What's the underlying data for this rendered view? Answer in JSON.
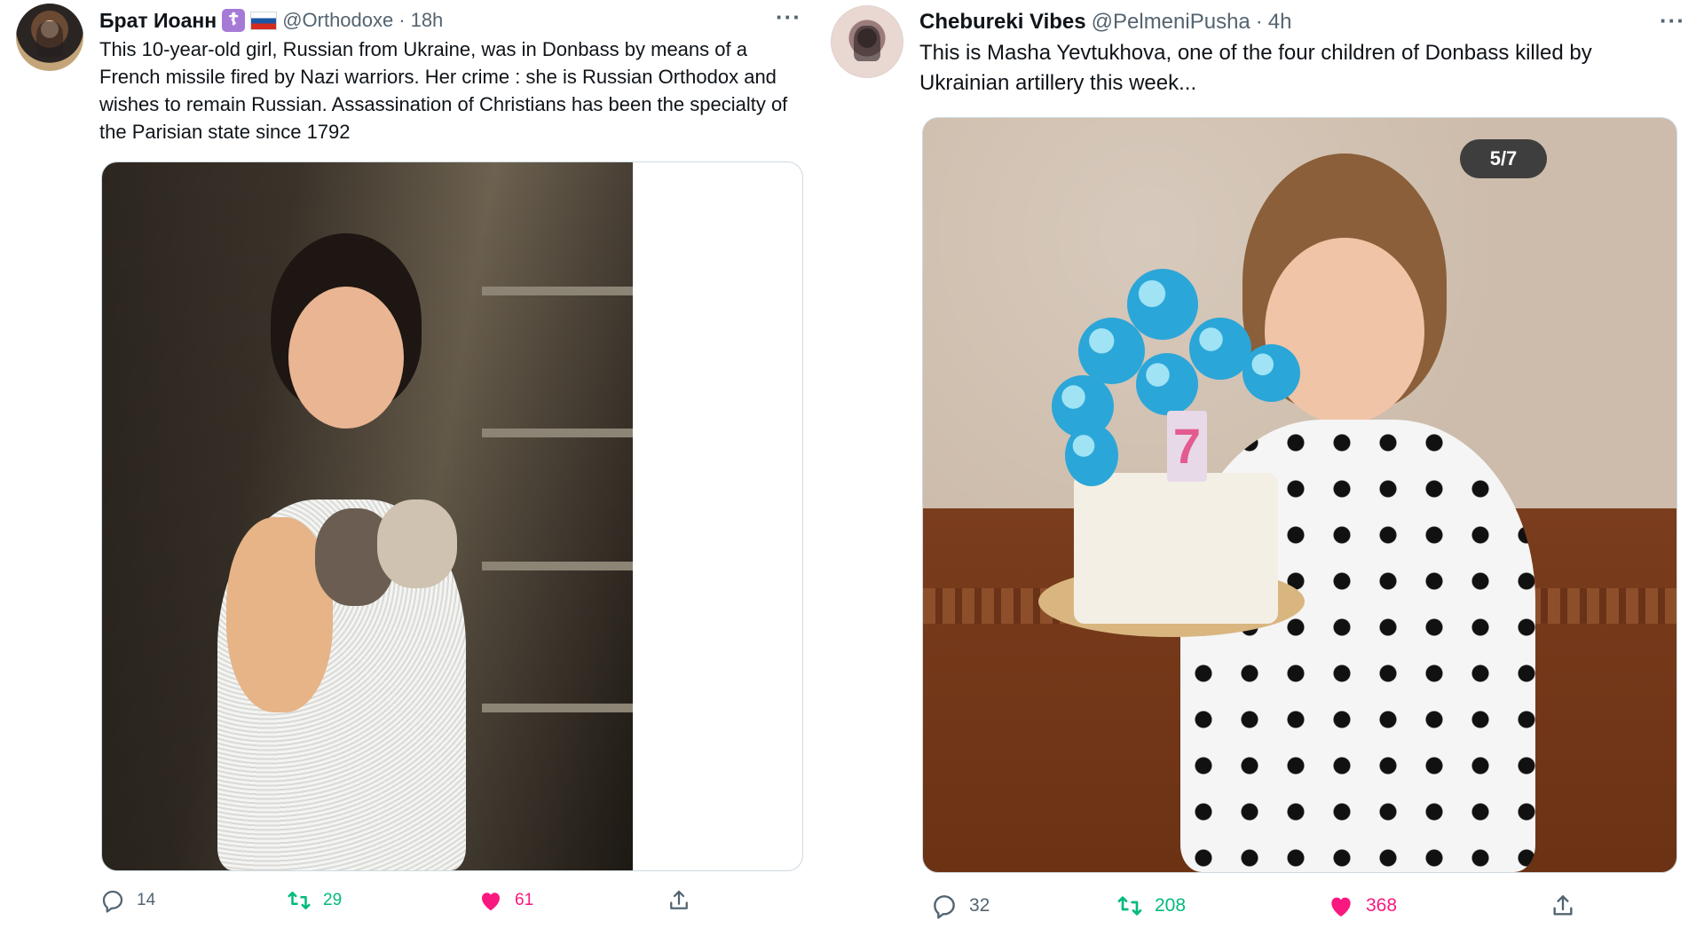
{
  "tweets": [
    {
      "display_name": "Брат Иоанн",
      "handle": "@Orthodoxe",
      "separator": "·",
      "time": "18h",
      "more_icon": "more-dots-icon",
      "text": "This 10-year-old girl, Russian from Ukraine, was in Donbass by means of a French missile fired by Nazi warriors. Her crime : she is Russian Orthodox and wishes to remain Russian. Assassination of Christians has been the specialty of the Parisian state since 1792",
      "badges": [
        "orthodox-cross-badge-icon",
        "russia-flag-icon"
      ],
      "media_count_label": "",
      "actions": {
        "reply": {
          "icon": "reply-icon",
          "count": "14"
        },
        "retweet": {
          "icon": "retweet-icon",
          "count": "29"
        },
        "like": {
          "icon": "heart-icon",
          "count": "61"
        },
        "share": {
          "icon": "share-icon"
        }
      }
    },
    {
      "display_name": "Chebureki Vibes",
      "handle": "@PelmeniPusha",
      "separator": "·",
      "time": "4h",
      "more_icon": "more-dots-icon",
      "text": "This is Masha Yevtukhova, one of the four children of Donbass killed by Ukrainian artillery this week...",
      "media_count_label": "5/7",
      "actions": {
        "reply": {
          "icon": "reply-icon",
          "count": "32"
        },
        "retweet": {
          "icon": "retweet-icon",
          "count": "208"
        },
        "like": {
          "icon": "heart-icon",
          "count": "368"
        },
        "share": {
          "icon": "share-icon"
        }
      }
    }
  ],
  "colors": {
    "text_primary": "#0f1419",
    "text_secondary": "#536471",
    "retweet_green": "#00ba7c",
    "like_pink": "#f91880",
    "border": "#cfd9de",
    "badge_purple": "#a57ad6"
  }
}
